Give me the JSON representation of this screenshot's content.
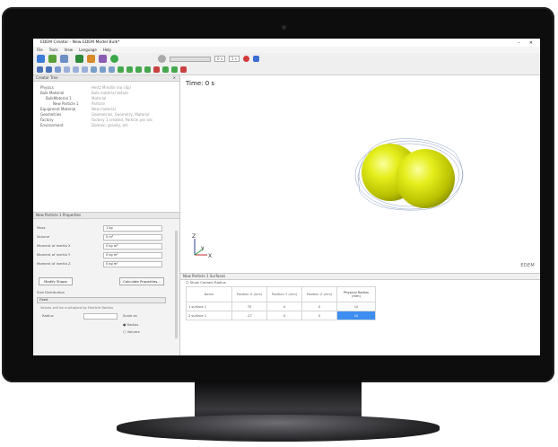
{
  "window": {
    "title": "EDEM Creator - New EDEM Model Bulk*",
    "controls": [
      "–",
      "✕"
    ]
  },
  "menu": [
    "File",
    "Tools",
    "View",
    "Language",
    "Help"
  ],
  "toolbar": {
    "time_field": "0 s",
    "fps_field": "1 s"
  },
  "explorer": {
    "title": "Creator Tree",
    "rows": [
      {
        "label": "Physics",
        "value": "Hertz Mindlin (no slip)",
        "indent": 0
      },
      {
        "label": "Bulk Material",
        "value": "Bulk material details",
        "indent": 0
      },
      {
        "label": "BulkMaterial 1",
        "value": "Material",
        "indent": 1
      },
      {
        "label": "New Particle 1",
        "value": "Particle",
        "indent": 2
      },
      {
        "label": "Equipment Material",
        "value": "New material",
        "indent": 0
      },
      {
        "label": "Geometries",
        "value": "Geometries, Geometry, Material",
        "indent": 0
      },
      {
        "label": "Factory",
        "value": "Factory 1 created, Particle per sec",
        "indent": 0
      },
      {
        "label": "Environment",
        "value": "Domain, gravity, etc",
        "indent": 0
      }
    ]
  },
  "properties": {
    "title": "New Particle 1 Properties",
    "rows": [
      {
        "label": "Mass",
        "value": "1 kg"
      },
      {
        "label": "Volume",
        "value": "0 m³"
      },
      {
        "label": "Moment of inertia X",
        "value": "0 kg m²"
      },
      {
        "label": "Moment of inertia Y",
        "value": "0 kg m²"
      },
      {
        "label": "Moment of inertia Z",
        "value": "0 kg m²"
      }
    ],
    "btn_left": "Modify Shape",
    "btn_right": "Calculate Properties...",
    "size_dist_label": "Size Distribution",
    "fixed_label": "Fixed",
    "size_note": "Values will be multiplied by Particle Radius",
    "radius_label": "Radius",
    "radius_option": "Scale as",
    "radio_options": [
      "Radius",
      "Volume"
    ]
  },
  "viewport": {
    "time_label": "Time: 0 s",
    "logo": "EDEM",
    "axis_z": "Z",
    "axis_y": "Y",
    "axis_x": "X"
  },
  "surfaces": {
    "title": "New Particle 1 Surfaces",
    "checkbox_label": "Show Contact Radius",
    "columns": [
      "Name",
      "Position X (mm)",
      "Position Y (mm)",
      "Position Z (mm)",
      "Physical Radius (mm)"
    ],
    "rows": [
      [
        "1  surface 1",
        "70",
        "0",
        "0",
        "10"
      ],
      [
        "2  surface 1",
        "-17",
        "0",
        "0",
        "10"
      ]
    ]
  }
}
